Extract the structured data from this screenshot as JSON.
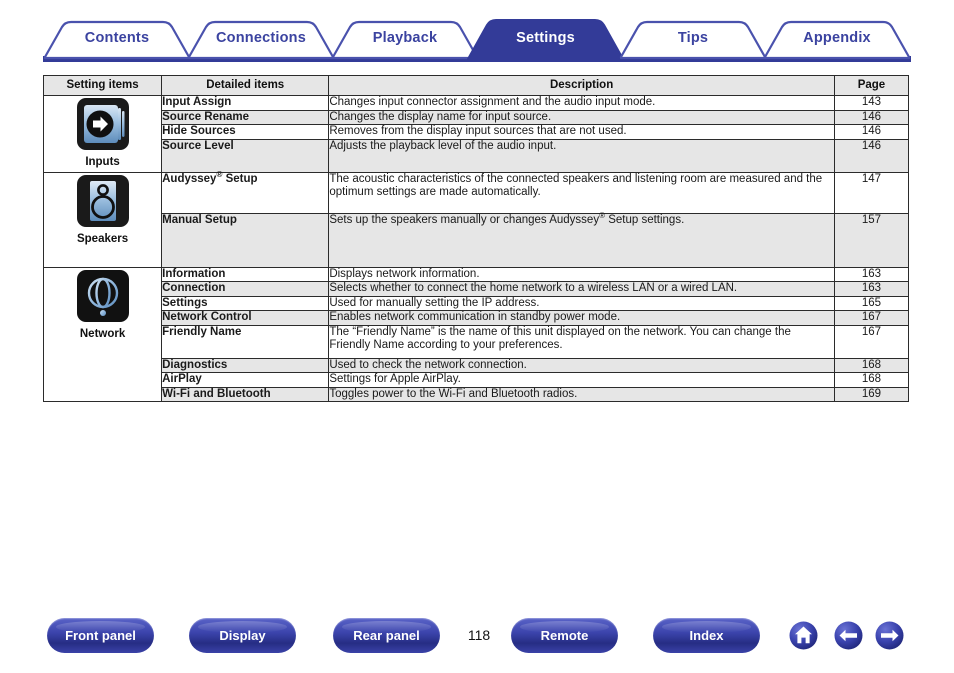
{
  "tabs": [
    {
      "label": "Contents",
      "active": false
    },
    {
      "label": "Connections",
      "active": false
    },
    {
      "label": "Playback",
      "active": false
    },
    {
      "label": "Settings",
      "active": true
    },
    {
      "label": "Tips",
      "active": false
    },
    {
      "label": "Appendix",
      "active": false
    }
  ],
  "table": {
    "headers": {
      "setting_items": "Setting items",
      "detailed_items": "Detailed items",
      "description": "Description",
      "page": "Page"
    },
    "groups": [
      {
        "icon": "inputs-icon",
        "caption": "Inputs",
        "rows": [
          {
            "detail": "Input Assign",
            "detail_sup": "",
            "desc": "Changes input connector assignment and the audio input mode.",
            "page": "143"
          },
          {
            "detail": "Source Rename",
            "detail_sup": "",
            "desc": "Changes the display name for input source.",
            "page": "146"
          },
          {
            "detail": "Hide Sources",
            "detail_sup": "",
            "desc": "Removes from the display input sources that are not used.",
            "page": "146"
          },
          {
            "detail": "Source Level",
            "detail_sup": "",
            "desc": "Adjusts the playback level of the audio input.",
            "page": "146"
          }
        ]
      },
      {
        "icon": "speakers-icon",
        "caption": "Speakers",
        "rows": [
          {
            "detail_pre": "Audyssey",
            "detail_sup": "®",
            "detail_post": " Setup",
            "desc_pre": "The acoustic characteristics of the connected speakers and listening room are measured and the optimum settings are made automatically.",
            "desc_sup": "",
            "desc_post": "",
            "page": "147"
          },
          {
            "detail_pre": "Manual Setup",
            "detail_sup": "",
            "detail_post": "",
            "desc_pre": "Sets up the speakers manually or changes Audyssey",
            "desc_sup": "®",
            "desc_post": " Setup settings.",
            "page": "157"
          }
        ]
      },
      {
        "icon": "network-icon",
        "caption": "Network",
        "rows": [
          {
            "detail": "Information",
            "desc": "Displays network information.",
            "page": "163"
          },
          {
            "detail": "Connection",
            "desc": "Selects whether to connect the home network to a wireless LAN or a wired LAN.",
            "page": "163"
          },
          {
            "detail": "Settings",
            "desc": "Used for manually setting the IP address.",
            "page": "165"
          },
          {
            "detail": "Network Control",
            "desc": "Enables network communication in standby power mode.",
            "page": "167"
          },
          {
            "detail": "Friendly Name",
            "desc": "The “Friendly Name” is the name of this unit displayed on the network. You can change the Friendly Name according to your preferences.",
            "page": "167"
          },
          {
            "detail": "Diagnostics",
            "desc": "Used to check the network connection.",
            "page": "168"
          },
          {
            "detail": "AirPlay",
            "desc": "Settings for Apple AirPlay.",
            "page": "168"
          },
          {
            "detail": "Wi-Fi and Bluetooth",
            "desc": "Toggles power to the Wi-Fi and Bluetooth radios.",
            "page": "169"
          }
        ]
      }
    ]
  },
  "footer": {
    "buttons": [
      {
        "label": "Front panel"
      },
      {
        "label": "Display"
      },
      {
        "label": "Rear panel"
      },
      {
        "label": "Remote"
      },
      {
        "label": "Index"
      }
    ],
    "page_number": "118",
    "nav_icons": [
      {
        "name": "home-icon"
      },
      {
        "name": "back-arrow-icon"
      },
      {
        "name": "forward-arrow-icon"
      }
    ]
  },
  "colors": {
    "brand_blue": "#3b43a0",
    "tab_active_fill": "#333b98",
    "table_shade": "#e6e6e6",
    "table_border": "#2b2b2b",
    "icon_blue": "#7fa8d4"
  }
}
